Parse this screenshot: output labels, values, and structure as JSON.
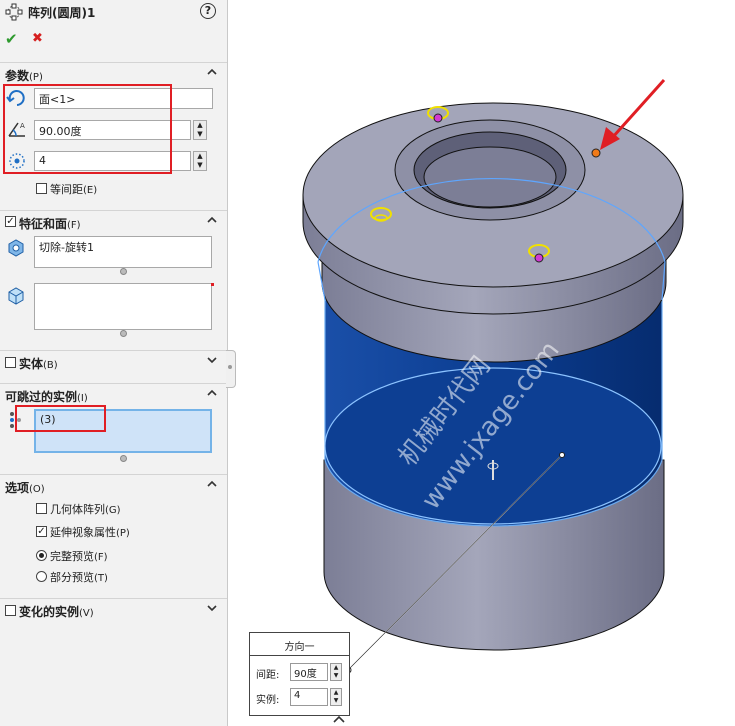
{
  "header": {
    "title": "阵列(圆周)1",
    "help": "?"
  },
  "actions": {
    "ok": "✔",
    "cancel": "✖"
  },
  "params": {
    "label": "参数",
    "key": "(P)",
    "axis_value": "面<1>",
    "angle_value": "90.00度",
    "count_value": "4",
    "equal_spacing": "等间距",
    "equal_spacing_key": "(E)"
  },
  "features": {
    "label": "特征和面",
    "key": "(F)",
    "feature_item": "切除-旋转1"
  },
  "bodies": {
    "label": "实体",
    "key": "(B)"
  },
  "skip": {
    "label": "可跳过的实例",
    "key": "(I)",
    "item": "(3)"
  },
  "options": {
    "label": "选项",
    "key": "(O)",
    "geometry_pattern": "几何体阵列",
    "geometry_pattern_key": "(G)",
    "propagate": "延伸视象属性",
    "propagate_key": "(P)",
    "full_preview": "完整预览",
    "full_preview_key": "(F)",
    "partial_preview": "部分预览",
    "partial_preview_key": "(T)"
  },
  "varied": {
    "label": "变化的实例",
    "key": "(V)"
  },
  "direction_box": {
    "title": "方向一",
    "spacing_label": "间距:",
    "spacing_value": "90度",
    "instances_label": "实例:",
    "instances_value": "4"
  },
  "watermark": {
    "line1": "机械时代网",
    "line2": "www.jxage.com"
  },
  "colors": {
    "accent_red": "#e01e24",
    "body_blue": "#0a3b8c",
    "model_gray": "#8d8fa6",
    "ok_green": "#2e9a2e"
  }
}
